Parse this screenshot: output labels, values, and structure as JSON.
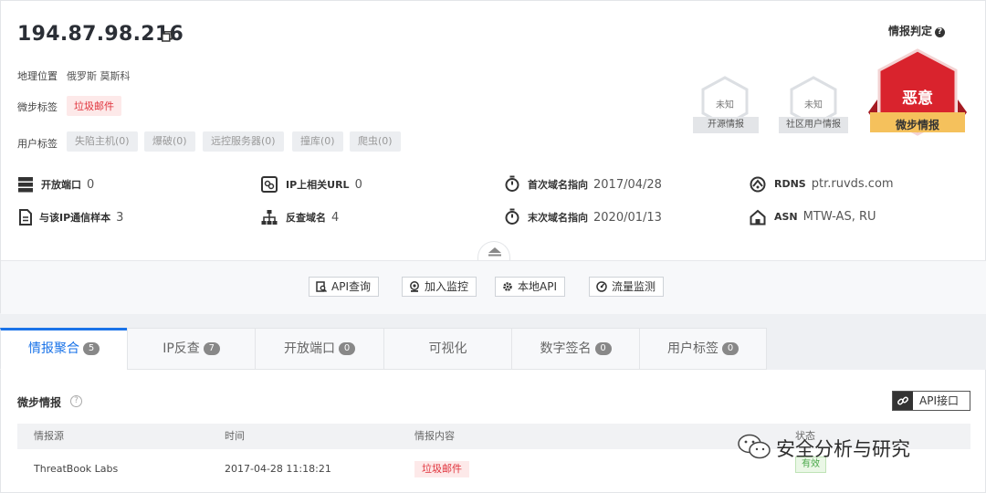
{
  "header": {
    "ip": "194.87.98.216",
    "geo_label": "地理位置",
    "geo_value": "俄罗斯 莫斯科",
    "weibu_tag_label": "微步标签",
    "weibu_tag": "垃圾邮件",
    "user_tag_label": "用户标签",
    "user_tags": [
      "失陷主机(0)",
      "爆破(0)",
      "远控服务器(0)",
      "撞库(0)",
      "爬虫(0)"
    ]
  },
  "verdict": {
    "title": "情报判定",
    "sources": [
      {
        "status": "未知",
        "label": "开源情报"
      },
      {
        "status": "未知",
        "label": "社区用户情报"
      }
    ],
    "main": {
      "status": "恶意",
      "label": "微步情报",
      "color": "#d9232d"
    }
  },
  "stats": [
    {
      "label": "开放端口",
      "value": "0",
      "icon": "server-icon"
    },
    {
      "label": "IP上相关URL",
      "value": "0",
      "icon": "link-icon"
    },
    {
      "label": "首次域名指向",
      "value": "2017/04/28",
      "icon": "stopwatch-icon"
    },
    {
      "label": "RDNS",
      "value": "ptr.ruvds.com",
      "icon": "dns-icon"
    },
    {
      "label": "与该IP通信样本",
      "value": "3",
      "icon": "file-icon"
    },
    {
      "label": "反查域名",
      "value": "4",
      "icon": "tree-icon"
    },
    {
      "label": "末次域名指向",
      "value": "2020/01/13",
      "icon": "stopwatch-icon"
    },
    {
      "label": "ASN",
      "value": "MTW-AS, RU",
      "icon": "home-icon"
    }
  ],
  "actions": [
    "API查询",
    "加入监控",
    "本地API",
    "流量监测"
  ],
  "tabs": [
    {
      "label": "情报聚合",
      "count": "5"
    },
    {
      "label": "IP反查",
      "count": "7"
    },
    {
      "label": "开放端口",
      "count": "0"
    },
    {
      "label": "可视化",
      "count": ""
    },
    {
      "label": "数字签名",
      "count": "0"
    },
    {
      "label": "用户标签",
      "count": "0"
    }
  ],
  "panel": {
    "title": "微步情报",
    "api_button": "API接口",
    "columns": [
      "情报源",
      "时间",
      "情报内容",
      "状态"
    ],
    "rows": [
      {
        "source": "ThreatBook Labs",
        "time": "2017-04-28 11:18:21",
        "content": "垃圾邮件",
        "status": "有效"
      }
    ]
  },
  "watermark": "安全分析与研究",
  "colors": {
    "accent": "#1a73e8",
    "malicious": "#d9232d",
    "ribbon_gold": "#f5c15c"
  }
}
